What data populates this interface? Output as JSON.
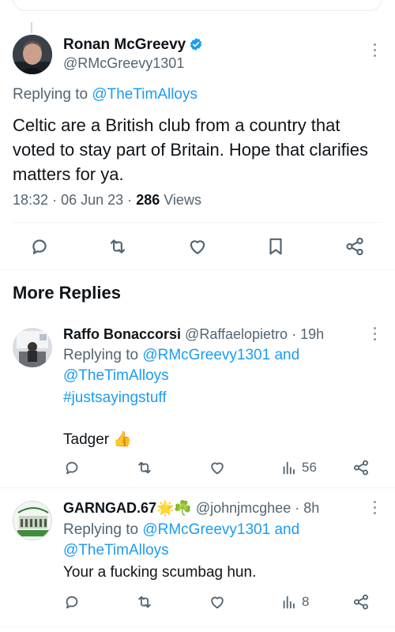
{
  "main_tweet": {
    "author_name": "Ronan McGreevy",
    "author_handle": "@RMcGreevy1301",
    "replying_prefix": "Replying to ",
    "replying_to": "@TheTimAlloys",
    "text": "Celtic are a British club from a country that voted to stay part of Britain. Hope that clarifies matters for ya.",
    "time": "18:32",
    "date": "06 Jun 23",
    "views_count": "286",
    "views_label": "Views",
    "separator": "·"
  },
  "section": {
    "title": "More Replies"
  },
  "replies": [
    {
      "author_name": "Raffo Bonaccorsi",
      "author_handle": "@Raffaelopietro",
      "age": "19h",
      "replying_prefix": "Replying to ",
      "replying_to_1": "@RMcGreevy1301",
      "and_word": " and",
      "replying_to_2": "@TheTimAlloys",
      "hashtag": "#justsayingstuff",
      "text": "Tadger 👍",
      "views": "56"
    },
    {
      "author_name": "GARNGAD.67🌟☘️",
      "author_handle": "@johnjmcghee",
      "age": "8h",
      "replying_prefix": "Replying to ",
      "replying_to_1": "@RMcGreevy1301",
      "and_word": " and",
      "replying_to_2": "@TheTimAlloys",
      "text": "Your a fucking scumbag hun.",
      "views": "8"
    }
  ],
  "icons": {
    "reply": "reply-icon",
    "retweet": "retweet-icon",
    "like": "like-icon",
    "bookmark": "bookmark-icon",
    "share": "share-icon",
    "views": "views-icon",
    "verified": "verified-badge-icon",
    "more": "more-options-icon"
  },
  "colors": {
    "accent": "#1d9bf0",
    "text_primary": "#0f1419",
    "text_secondary": "#536471",
    "divider": "#eff3f4"
  }
}
